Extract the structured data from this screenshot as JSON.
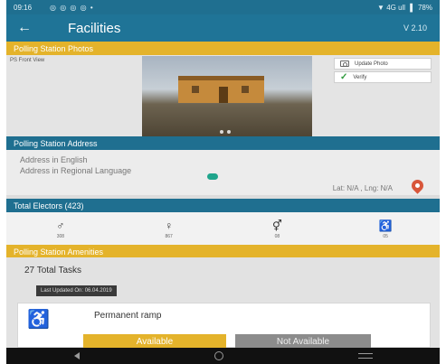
{
  "status_bar": {
    "time": "09:16",
    "notifications": "◎ ◎ ◎ ◎ •",
    "signal": "▼ 4G ull ▐",
    "battery": "78%"
  },
  "app_bar": {
    "title": "Facilities",
    "version": "V 2.10",
    "back_icon": "arrow-left-icon"
  },
  "photos_section": {
    "header": "Polling Station Photos",
    "photo_label": "PS Front View",
    "update_label": "Update Photo",
    "verify_label": "Verify"
  },
  "address_section": {
    "header": "Polling Station Address",
    "english": "Address in English",
    "regional": "Address in Regional Language",
    "latlng": "Lat: N/A , Lng: N/A"
  },
  "electors_section": {
    "header": "Total Electors",
    "count": "(423)",
    "items": [
      {
        "glyph": "♂",
        "caption": "308",
        "icon": "male-icon"
      },
      {
        "glyph": "♀",
        "caption": "867",
        "icon": "female-icon"
      },
      {
        "glyph": "⚥",
        "caption": "08",
        "icon": "third-gender-icon"
      },
      {
        "glyph": "♿",
        "caption": "05",
        "icon": "pwd-icon"
      }
    ]
  },
  "amenities_section": {
    "header": "Polling Station Amenities",
    "total_tasks": "27 Total Tasks",
    "chip": "Last Updated On: 06.04.2019",
    "card_title": "Permanent ramp",
    "available": "Available",
    "not_available": "Not Available"
  },
  "colors": {
    "primary": "#1f7497",
    "accent": "#e4b32b",
    "verify": "#2f9a3d"
  }
}
